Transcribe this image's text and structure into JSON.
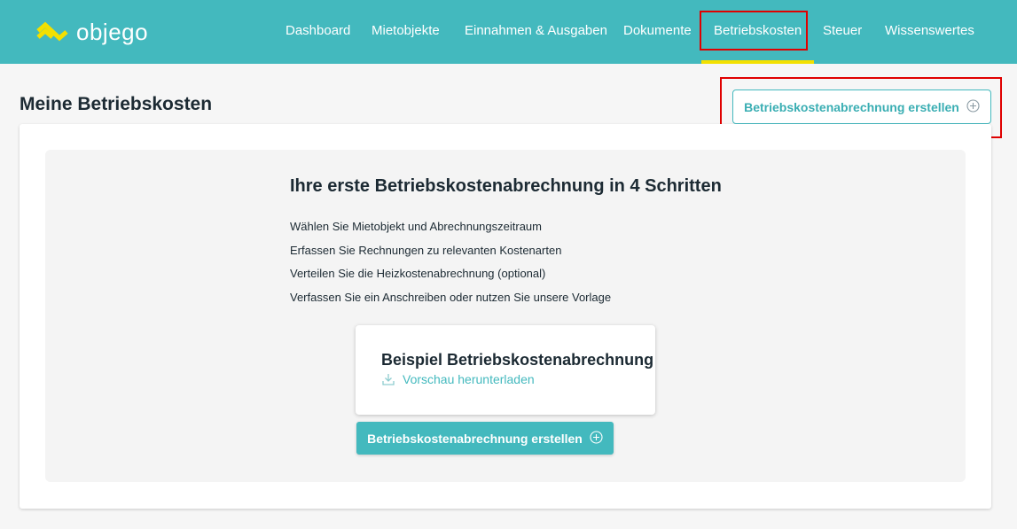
{
  "brand": {
    "name": "objego",
    "logo_color": "#f3e000"
  },
  "colors": {
    "topbar": "#43b9be",
    "accent": "#43b9be",
    "active_underline": "#f3e000",
    "highlight": "#e00000"
  },
  "nav": {
    "items": [
      {
        "label": "Dashboard"
      },
      {
        "label": "Mietobjekte"
      },
      {
        "label": "Einnahmen & Ausgaben"
      },
      {
        "label": "Dokumente"
      },
      {
        "label": "Betriebskosten",
        "active": true
      },
      {
        "label": "Steuer"
      },
      {
        "label": "Wissenswertes"
      }
    ]
  },
  "page": {
    "title": "Meine Betriebskosten",
    "header_button_label": "Betriebskostenabrechnung erstellen",
    "header_button_icon": "plus-circle-icon"
  },
  "intro": {
    "title": "Ihre erste Betriebskostenabrechnung in 4 Schritten",
    "steps": [
      "Wählen Sie Mietobjekt und Abrechnungszeitraum",
      "Erfassen Sie Rechnungen zu relevanten Kostenarten",
      "Verteilen Sie die Heizkostenabrechnung (optional)",
      "Verfassen Sie ein Anschreiben oder nutzen Sie unsere Vorlage"
    ]
  },
  "example": {
    "title": "Beispiel Betriebskostenabrechnung",
    "download_label": "Vorschau herunterladen",
    "download_icon": "download-icon"
  },
  "cta": {
    "label": "Betriebskostenabrechnung erstellen",
    "icon": "plus-circle-icon"
  }
}
